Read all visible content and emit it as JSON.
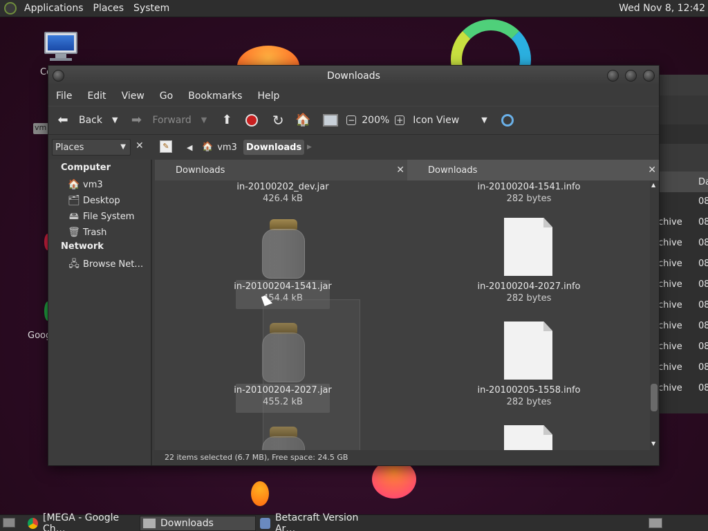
{
  "top_panel": {
    "menus": [
      "Applications",
      "Places",
      "System"
    ],
    "clock": "Wed Nov  8, 12:42"
  },
  "desktop": {
    "icons": [
      {
        "label": "Co",
        "icon": "computer-icon"
      },
      {
        "label": "Goog",
        "icon": "chrome-icon"
      }
    ],
    "side_tag": "vm"
  },
  "window": {
    "title": "Downloads",
    "menu": [
      "File",
      "Edit",
      "View",
      "Go",
      "Bookmarks",
      "Help"
    ],
    "toolbar": {
      "back": "Back",
      "forward": "Forward",
      "zoom": "200%",
      "view_mode": "Icon View"
    },
    "places_label": "Places",
    "breadcrumbs": [
      "vm3",
      "Downloads"
    ],
    "sidebar": {
      "computer_head": "Computer",
      "computer_items": [
        "vm3",
        "Desktop",
        "File System",
        "Trash"
      ],
      "network_head": "Network",
      "network_items": [
        "Browse Net…"
      ]
    },
    "left_pane": {
      "tab": "Downloads",
      "files": [
        {
          "name": "in-20100202_dev.jar",
          "size": "426.4 kB"
        },
        {
          "name": "in-20100204-1541.jar",
          "size": "454.4 kB"
        },
        {
          "name": "in-20100204-2027.jar",
          "size": "455.2 kB"
        }
      ]
    },
    "right_pane": {
      "tab": "Downloads",
      "files": [
        {
          "name": "in-20100204-1541.info",
          "size": "282 bytes"
        },
        {
          "name": "in-20100204-2027.info",
          "size": "282 bytes"
        },
        {
          "name": "in-20100205-1558.info",
          "size": "282 bytes"
        }
      ]
    },
    "status": "22 items selected (6.7 MB), Free space: 24.5 GB"
  },
  "bg_window": {
    "column_header": "Da",
    "rows": [
      {
        "type": "",
        "date": "08"
      },
      {
        "type": "chive",
        "date": "08"
      },
      {
        "type": "chive",
        "date": "08"
      },
      {
        "type": "chive",
        "date": "08"
      },
      {
        "type": "chive",
        "date": "08"
      },
      {
        "type": "chive",
        "date": "08"
      },
      {
        "type": "chive",
        "date": "08"
      },
      {
        "type": "chive",
        "date": "08"
      },
      {
        "type": "chive",
        "date": "08"
      },
      {
        "type": "chive",
        "date": "08"
      }
    ]
  },
  "taskbar": {
    "items": [
      "[MEGA - Google Ch…",
      "Downloads",
      "Betacraft Version Ar…"
    ]
  }
}
